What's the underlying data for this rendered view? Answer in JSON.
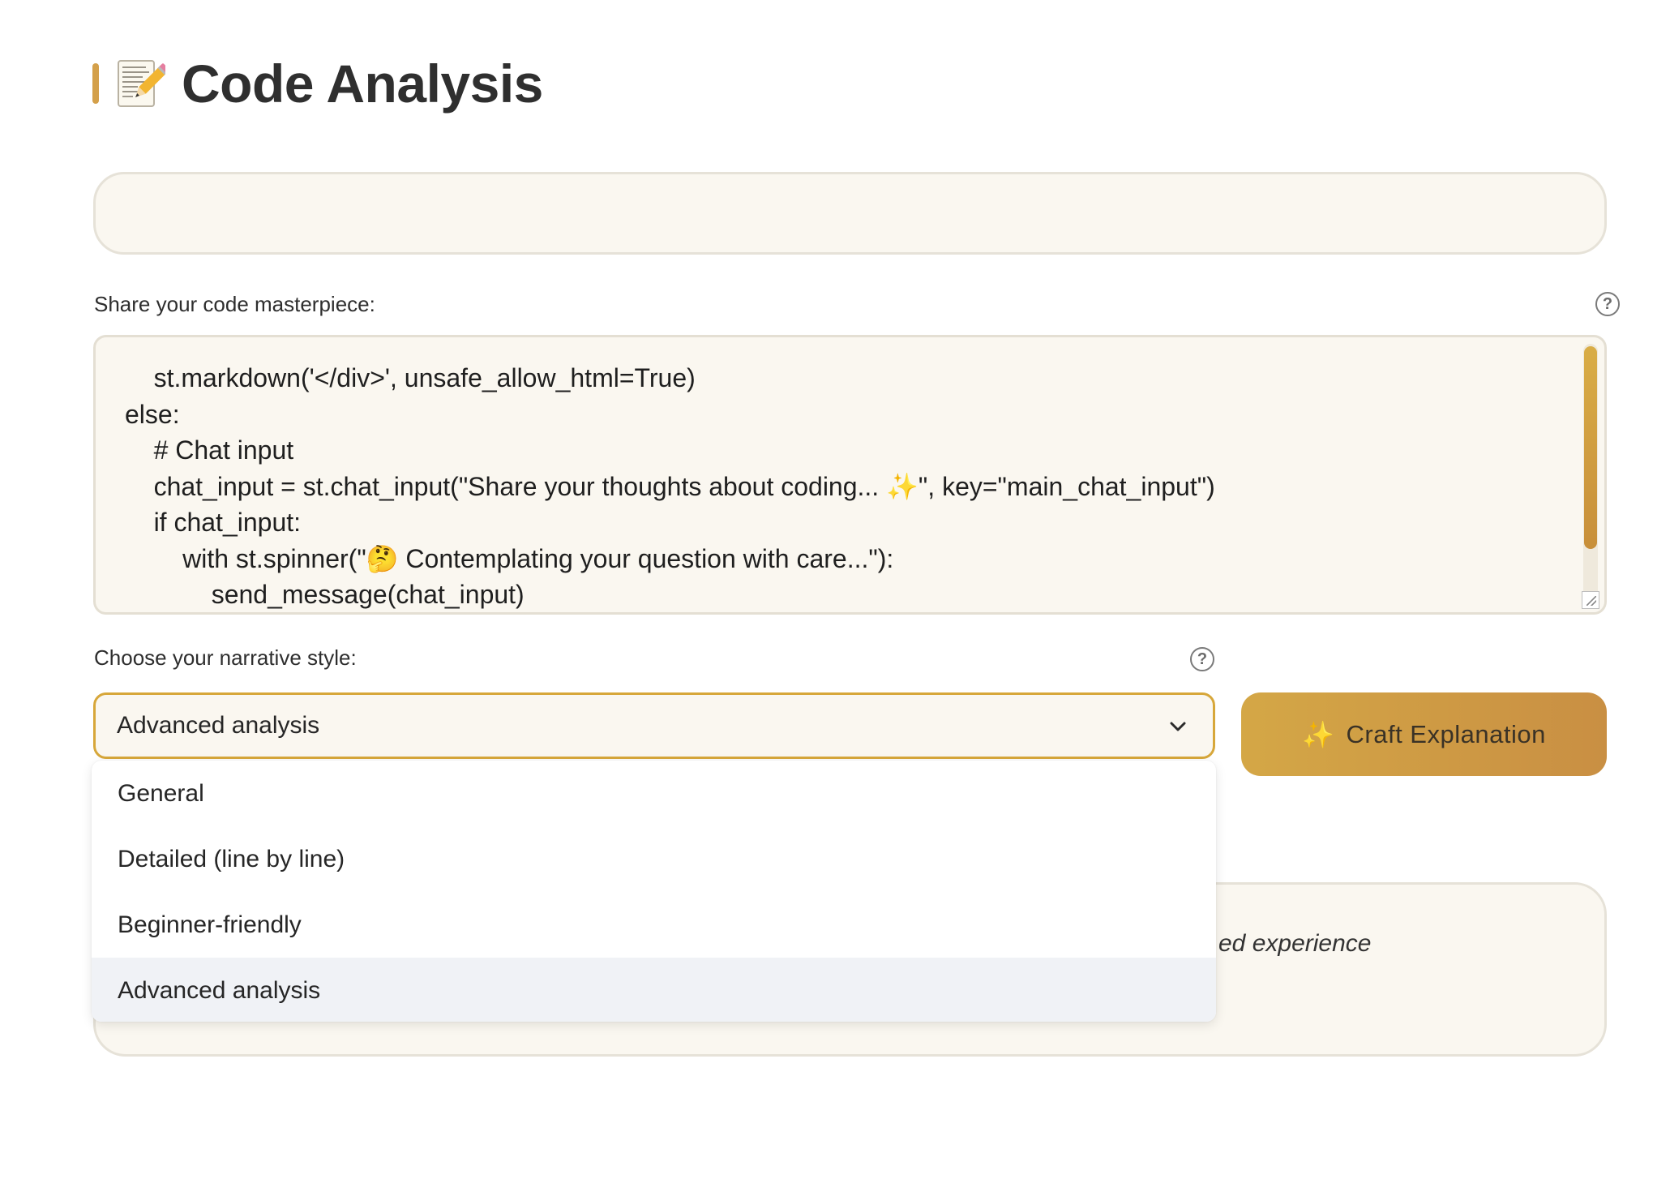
{
  "page": {
    "title": "Code Analysis",
    "title_emoji": "memo-pencil-icon",
    "accent_color": "#d4a04a"
  },
  "code_input": {
    "label": "Share your code masterpiece:",
    "lines": [
      "    st.markdown('</div>', unsafe_allow_html=True)",
      "else:",
      "    # Chat input",
      "    chat_input = st.chat_input(\"Share your thoughts about coding... ✨\", key=\"main_chat_input\")",
      "    if chat_input:",
      "        with st.spinner(\"🤔 Contemplating your question with care...\"):",
      "            send_message(chat_input)"
    ]
  },
  "style_select": {
    "label": "Choose your narrative style:",
    "selected": "Advanced analysis",
    "options": [
      "General",
      "Detailed (line by line)",
      "Beginner-friendly",
      "Advanced analysis"
    ],
    "border_color": "#d7a73a"
  },
  "craft_button": {
    "icon": "✨",
    "label": "Craft Explanation"
  },
  "bottom_panel": {
    "partial_text": "ed experience"
  }
}
